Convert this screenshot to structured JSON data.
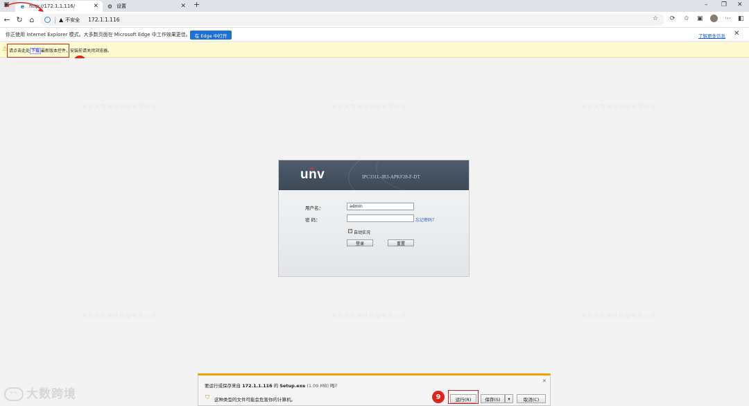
{
  "browser": {
    "tabs": [
      {
        "title": "http://172.1.1.116/",
        "icon": "e"
      },
      {
        "title": "设置",
        "icon": "⚙"
      }
    ],
    "address": {
      "insecure_label": "不安全",
      "url": "172.1.1.116"
    }
  },
  "ie_notice": {
    "text": "你正使用 Internet Explorer 模式。大多数页面在 Microsoft Edge 中工作效果更佳。",
    "button": "在 Edge 中打开",
    "learn_more": "了解更多信息"
  },
  "plugin_notice": {
    "prefix": "请点击此处",
    "link": "下载",
    "suffix": "最新版本控件，安装前请关闭浏览器。"
  },
  "markers": {
    "first": "8",
    "second": "9"
  },
  "watermark": "北京大数跨境科技有限公司",
  "login": {
    "logo": "unv",
    "model": "IPC331L-IR3-APKF28-F-DT",
    "username_label": "用户名：",
    "username_value": "admin",
    "password_label": "密  码：",
    "forgot": "忘记密码？",
    "auto_login": "自动实况",
    "login_button": "登录",
    "reset_button": "重置"
  },
  "download": {
    "question_prefix": "要运行或保存来自",
    "host": "172.1.1.116",
    "question_mid": "的",
    "file": "Setup.exe",
    "size": "(1.09 MB)",
    "question_suffix": "吗?",
    "warning": "这种类型的文件可能会危害你的计算机。",
    "run": "运行(R)",
    "save": "保存(S)",
    "cancel": "取消(C)"
  },
  "brand": "大数跨境",
  "colors": {
    "accent": "#1f6fd6",
    "marker": "#e0241a",
    "warning_bar": "#fffbd0"
  }
}
